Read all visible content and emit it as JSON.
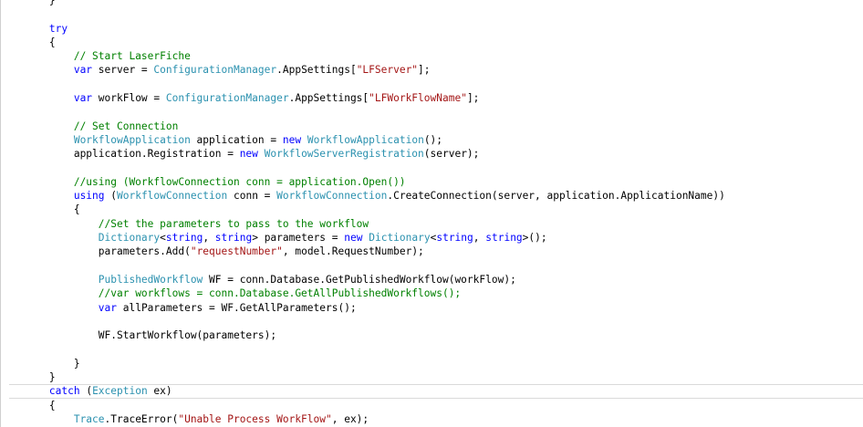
{
  "editor": {
    "indent_unit": "    ",
    "lines": [
      {
        "indent": 2,
        "tokens": [
          {
            "t": "plain",
            "v": "}"
          }
        ]
      },
      {
        "indent": 0,
        "tokens": []
      },
      {
        "indent": 2,
        "tokens": [
          {
            "t": "kw",
            "v": "try"
          }
        ]
      },
      {
        "indent": 2,
        "tokens": [
          {
            "t": "plain",
            "v": "{"
          }
        ]
      },
      {
        "indent": 3,
        "tokens": [
          {
            "t": "comment",
            "v": "// Start LaserFiche"
          }
        ]
      },
      {
        "indent": 3,
        "tokens": [
          {
            "t": "kw",
            "v": "var"
          },
          {
            "t": "plain",
            "v": " server = "
          },
          {
            "t": "type",
            "v": "ConfigurationManager"
          },
          {
            "t": "plain",
            "v": ".AppSettings["
          },
          {
            "t": "str",
            "v": "\"LFServer\""
          },
          {
            "t": "plain",
            "v": "];"
          }
        ]
      },
      {
        "indent": 0,
        "tokens": []
      },
      {
        "indent": 3,
        "tokens": [
          {
            "t": "kw",
            "v": "var"
          },
          {
            "t": "plain",
            "v": " workFlow = "
          },
          {
            "t": "type",
            "v": "ConfigurationManager"
          },
          {
            "t": "plain",
            "v": ".AppSettings["
          },
          {
            "t": "str",
            "v": "\"LFWorkFlowName\""
          },
          {
            "t": "plain",
            "v": "];"
          }
        ]
      },
      {
        "indent": 0,
        "tokens": []
      },
      {
        "indent": 3,
        "tokens": [
          {
            "t": "comment",
            "v": "// Set Connection"
          }
        ]
      },
      {
        "indent": 3,
        "tokens": [
          {
            "t": "type",
            "v": "WorkflowApplication"
          },
          {
            "t": "plain",
            "v": " application = "
          },
          {
            "t": "kw",
            "v": "new"
          },
          {
            "t": "plain",
            "v": " "
          },
          {
            "t": "type",
            "v": "WorkflowApplication"
          },
          {
            "t": "plain",
            "v": "();"
          }
        ]
      },
      {
        "indent": 3,
        "tokens": [
          {
            "t": "plain",
            "v": "application.Registration = "
          },
          {
            "t": "kw",
            "v": "new"
          },
          {
            "t": "plain",
            "v": " "
          },
          {
            "t": "type",
            "v": "WorkflowServerRegistration"
          },
          {
            "t": "plain",
            "v": "(server);"
          }
        ]
      },
      {
        "indent": 0,
        "tokens": []
      },
      {
        "indent": 3,
        "tokens": [
          {
            "t": "comment",
            "v": "//using (WorkflowConnection conn = application.Open())"
          }
        ]
      },
      {
        "indent": 3,
        "tokens": [
          {
            "t": "kw",
            "v": "using"
          },
          {
            "t": "plain",
            "v": " ("
          },
          {
            "t": "type",
            "v": "WorkflowConnection"
          },
          {
            "t": "plain",
            "v": " conn = "
          },
          {
            "t": "type",
            "v": "WorkflowConnection"
          },
          {
            "t": "plain",
            "v": ".CreateConnection(server, application.ApplicationName))"
          }
        ]
      },
      {
        "indent": 3,
        "tokens": [
          {
            "t": "plain",
            "v": "{"
          }
        ]
      },
      {
        "indent": 4,
        "tokens": [
          {
            "t": "comment",
            "v": "//Set the parameters to pass to the workflow"
          }
        ]
      },
      {
        "indent": 4,
        "tokens": [
          {
            "t": "type",
            "v": "Dictionary"
          },
          {
            "t": "plain",
            "v": "<"
          },
          {
            "t": "kw",
            "v": "string"
          },
          {
            "t": "plain",
            "v": ", "
          },
          {
            "t": "kw",
            "v": "string"
          },
          {
            "t": "plain",
            "v": "> parameters = "
          },
          {
            "t": "kw",
            "v": "new"
          },
          {
            "t": "plain",
            "v": " "
          },
          {
            "t": "type",
            "v": "Dictionary"
          },
          {
            "t": "plain",
            "v": "<"
          },
          {
            "t": "kw",
            "v": "string"
          },
          {
            "t": "plain",
            "v": ", "
          },
          {
            "t": "kw",
            "v": "string"
          },
          {
            "t": "plain",
            "v": ">();"
          }
        ]
      },
      {
        "indent": 4,
        "tokens": [
          {
            "t": "plain",
            "v": "parameters.Add("
          },
          {
            "t": "str",
            "v": "\"requestNumber\""
          },
          {
            "t": "plain",
            "v": ", model.RequestNumber);"
          }
        ]
      },
      {
        "indent": 0,
        "tokens": []
      },
      {
        "indent": 4,
        "tokens": [
          {
            "t": "type",
            "v": "PublishedWorkflow"
          },
          {
            "t": "plain",
            "v": " WF = conn.Database.GetPublishedWorkflow(workFlow);"
          }
        ]
      },
      {
        "indent": 4,
        "tokens": [
          {
            "t": "comment",
            "v": "//var workflows = conn.Database.GetAllPublishedWorkflows();"
          }
        ]
      },
      {
        "indent": 4,
        "tokens": [
          {
            "t": "kw",
            "v": "var"
          },
          {
            "t": "plain",
            "v": " allParameters = WF.GetAllParameters();"
          }
        ]
      },
      {
        "indent": 0,
        "tokens": []
      },
      {
        "indent": 4,
        "tokens": [
          {
            "t": "plain",
            "v": "WF.StartWorkflow(parameters);"
          }
        ]
      },
      {
        "indent": 0,
        "tokens": []
      },
      {
        "indent": 3,
        "tokens": [
          {
            "t": "plain",
            "v": "}"
          }
        ]
      },
      {
        "indent": 2,
        "tokens": [
          {
            "t": "plain",
            "v": "}"
          }
        ]
      },
      {
        "indent": 2,
        "current": true,
        "tokens": [
          {
            "t": "kw",
            "v": "catch"
          },
          {
            "t": "plain",
            "v": " ("
          },
          {
            "t": "type",
            "v": "Exception"
          },
          {
            "t": "plain",
            "v": " ex)"
          }
        ]
      },
      {
        "indent": 2,
        "tokens": [
          {
            "t": "plain",
            "v": "{"
          }
        ]
      },
      {
        "indent": 3,
        "tokens": [
          {
            "t": "type",
            "v": "Trace"
          },
          {
            "t": "plain",
            "v": ".TraceError("
          },
          {
            "t": "str",
            "v": "\"Unable Process WorkFlow\""
          },
          {
            "t": "plain",
            "v": ", ex);"
          }
        ]
      }
    ]
  },
  "colors": {
    "keyword": "#0000ff",
    "type": "#2b91af",
    "string": "#a31515",
    "comment": "#008000",
    "plain": "#000000",
    "background": "#ffffff"
  }
}
